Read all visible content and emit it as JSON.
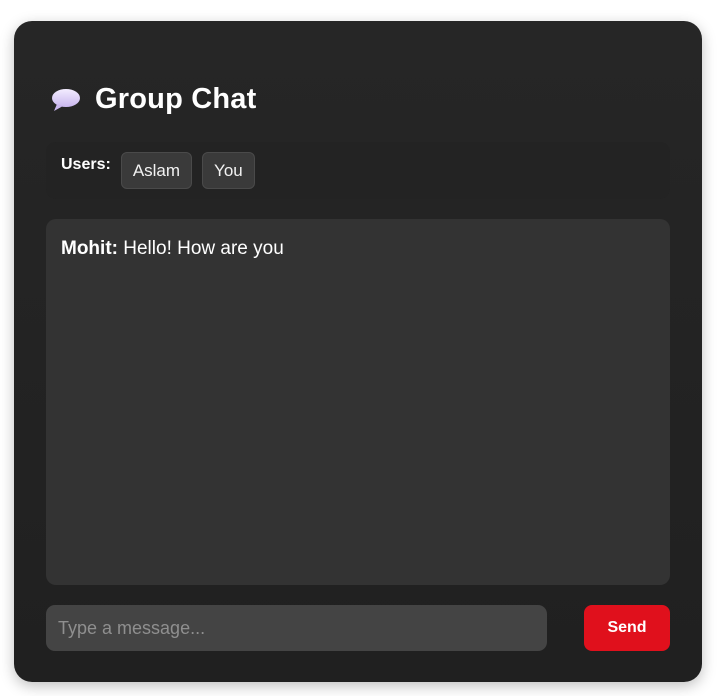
{
  "header": {
    "icon": "speech-bubble-icon",
    "title": "Group Chat"
  },
  "users": {
    "label": "Users:",
    "list": [
      "Aslam",
      "You"
    ]
  },
  "messages": [
    {
      "sender": "Mohit:",
      "text": "Hello! How are you"
    }
  ],
  "composer": {
    "placeholder": "Type a message...",
    "value": "",
    "send_label": "Send"
  },
  "colors": {
    "card_bg": "#232323",
    "messages_bg": "#333333",
    "input_bg": "#444444",
    "send_button": "#e0101c",
    "text": "#ffffff"
  }
}
